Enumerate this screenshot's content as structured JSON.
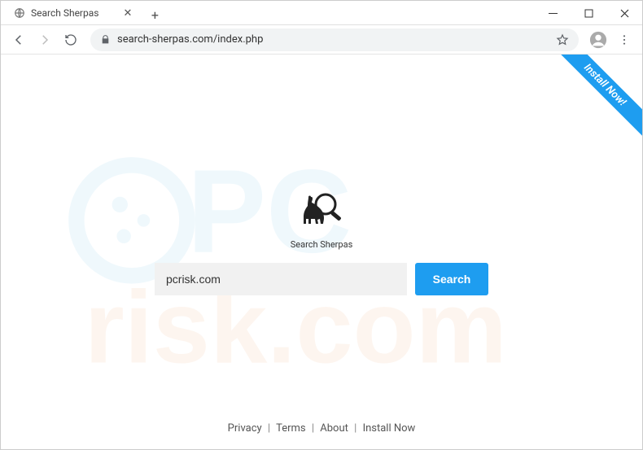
{
  "window": {
    "tab_title": "Search Sherpas",
    "controls": {
      "minimize": "–",
      "maximize": "☐",
      "close": "✕"
    }
  },
  "toolbar": {
    "url": "search-sherpas.com/index.php"
  },
  "ribbon": {
    "label": "Install Now!"
  },
  "brand": {
    "name": "Search Sherpas"
  },
  "search": {
    "value": "pcrisk.com",
    "placeholder": "",
    "button_label": "Search"
  },
  "footer": {
    "links": {
      "privacy": "Privacy",
      "terms": "Terms",
      "about": "About",
      "install_now": "Install Now"
    },
    "sep": "|"
  },
  "watermark": {
    "text": "risk.com"
  }
}
